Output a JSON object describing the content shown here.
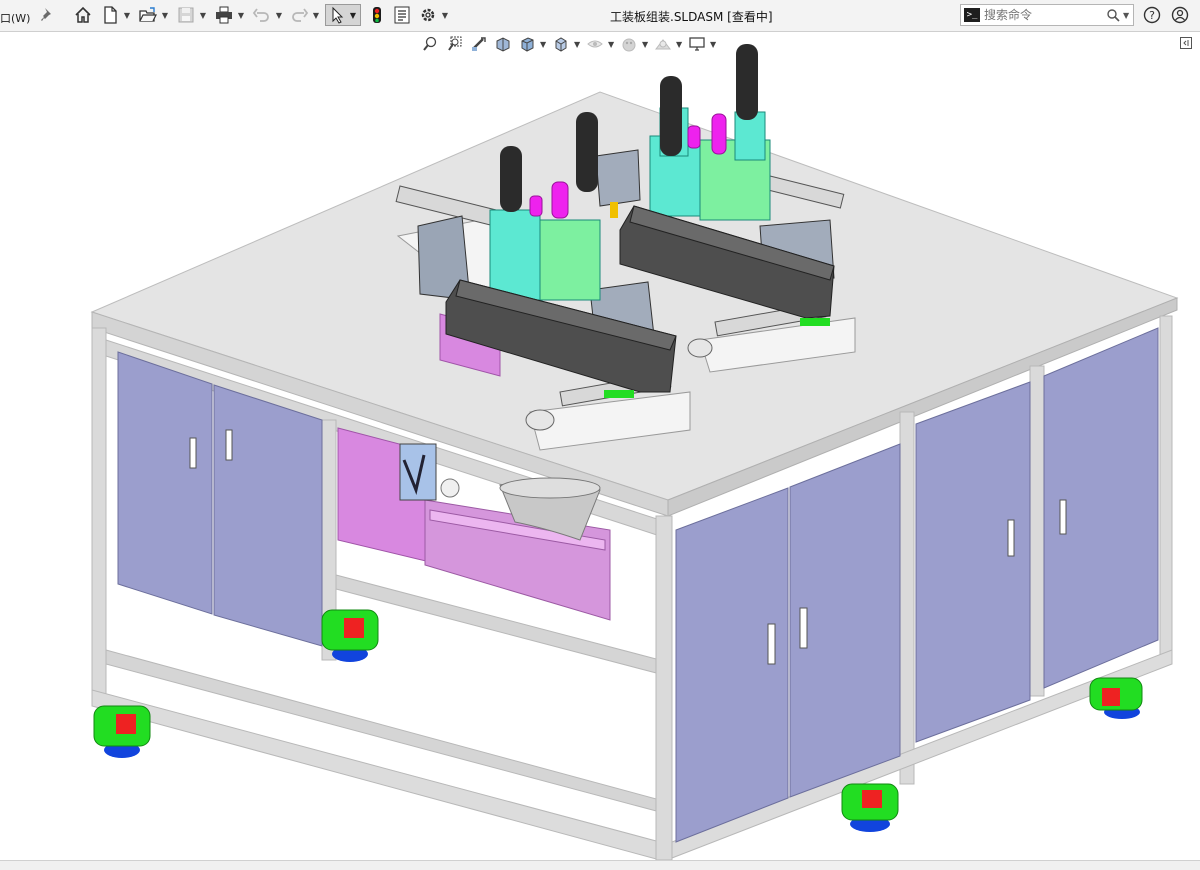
{
  "toolbar": {
    "window_menu_label": "口(W)",
    "pin_icon": "pin-icon",
    "icons": [
      "home-icon",
      "new-document-icon",
      "open-icon",
      "save-icon",
      "print-icon",
      "undo-icon",
      "redo-icon",
      "select-icon",
      "rebuild-icon",
      "file-properties-icon",
      "options-icon"
    ]
  },
  "title": "工装板组装.SLDASM [查看中]",
  "search": {
    "placeholder": "搜索命令"
  },
  "right_icons": [
    "help-icon",
    "user-icon"
  ],
  "heads_up_toolbar": [
    "zoom-to-fit-icon",
    "zoom-to-area-icon",
    "previous-view-icon",
    "section-view-icon",
    "view-orientation-icon",
    "display-style-icon",
    "hide-show-icon",
    "edit-appearance-icon",
    "apply-scene-icon",
    "view-settings-icon"
  ],
  "colors": {
    "table_top": "#e6e6e6",
    "frame": "#dcdcdc",
    "door_panel": "#9b9ecd",
    "cylinder": "#2b2b2b",
    "bracket": "#5ce8d2",
    "accent_magenta": "#ee22ee",
    "caster_green": "#22dd22",
    "caster_blue": "#1144dd",
    "caster_red": "#ee2222",
    "pink_box": "#d88be0"
  }
}
